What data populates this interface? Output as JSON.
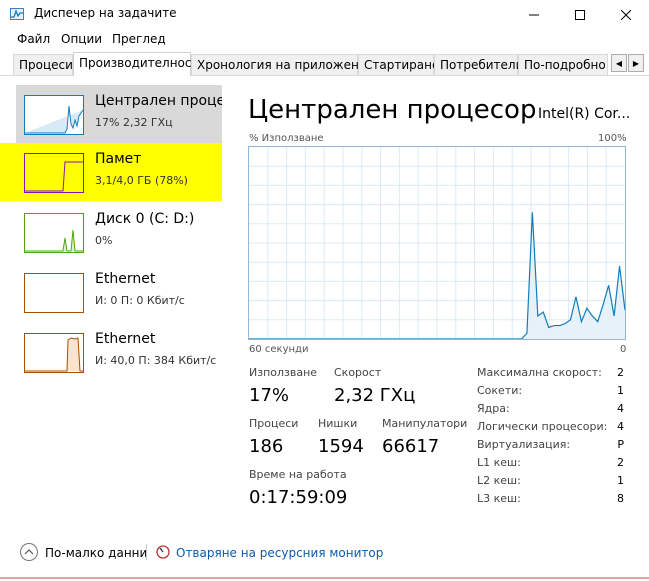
{
  "window": {
    "title": "Диспечер на задачите",
    "icon": "task-manager-icon"
  },
  "menu": [
    "Файл",
    "Опции",
    "Преглед"
  ],
  "tabs": [
    {
      "label": "Процеси",
      "active": false
    },
    {
      "label": "Производителност",
      "active": true
    },
    {
      "label": "Хронология на приложение",
      "active": false
    },
    {
      "label": "Стартиране",
      "active": false
    },
    {
      "label": "Потребители",
      "active": false
    },
    {
      "label": "По-подробно",
      "active": false
    }
  ],
  "sidebar": {
    "items": [
      {
        "title": "Централен процесор",
        "sub": "17% 2,32 ГХц"
      },
      {
        "title": "Памет",
        "sub": "3,1/4,0 ГБ (78%)"
      },
      {
        "title": "Диск 0 (C: D:)",
        "sub": "0%"
      },
      {
        "title": "Ethernet",
        "sub": "И: 0 П: 0 Кбит/с"
      },
      {
        "title": "Ethernet",
        "sub": "И: 40,0 П: 384 Кбит/с"
      }
    ]
  },
  "main": {
    "title": "Централен процесор",
    "model": "Intel(R) Cor...",
    "graph": {
      "top_left": "% Използване",
      "top_right": "100%",
      "bottom_left": "60 секунди",
      "bottom_right": "0",
      "usage": [
        0,
        0,
        0,
        0,
        0,
        0,
        0,
        0,
        0,
        0,
        0,
        0,
        0,
        0,
        0,
        0,
        0,
        0,
        0,
        0,
        0,
        0,
        0,
        0,
        0,
        0,
        0,
        0,
        0,
        0,
        0,
        0,
        0,
        0,
        0,
        0,
        0,
        0,
        0,
        0,
        0,
        0,
        0,
        0,
        0,
        0,
        0,
        0,
        0,
        0,
        0,
        3,
        66,
        12,
        14,
        6,
        7,
        7,
        8,
        10,
        22,
        9,
        16,
        12,
        9,
        18,
        28,
        12,
        38,
        15
      ]
    },
    "stats": {
      "usage_label": "Използване",
      "usage_value": "17%",
      "speed_label": "Скорост",
      "speed_value": "2,32 ГХц",
      "processes_label": "Процеси",
      "processes_value": "186",
      "threads_label": "Нишки",
      "threads_value": "1594",
      "handles_label": "Манипулатори",
      "handles_value": "66617",
      "uptime_label": "Време на работа",
      "uptime_value": "0:17:59:09"
    },
    "specs": [
      {
        "label": "Максимална скорост:",
        "value": "2"
      },
      {
        "label": "Сокети:",
        "value": "1"
      },
      {
        "label": "Ядра:",
        "value": "4"
      },
      {
        "label": "Логически процесори:",
        "value": "4"
      },
      {
        "label": "Виртуализация:",
        "value": "Р"
      },
      {
        "label": "L1 кеш:",
        "value": "2"
      },
      {
        "label": "L2 кеш:",
        "value": "1"
      },
      {
        "label": "L3 кеш:",
        "value": "8"
      }
    ]
  },
  "footer": {
    "fewer_details": "По-малко данни",
    "resource_monitor": "Отваряне на ресурсния монитор"
  },
  "colors": {
    "accent": "#117dbb",
    "memory": "#8b12ae",
    "disk": "#4da60c",
    "ethernet": "#a74f01",
    "highlight": "#ffff00"
  }
}
